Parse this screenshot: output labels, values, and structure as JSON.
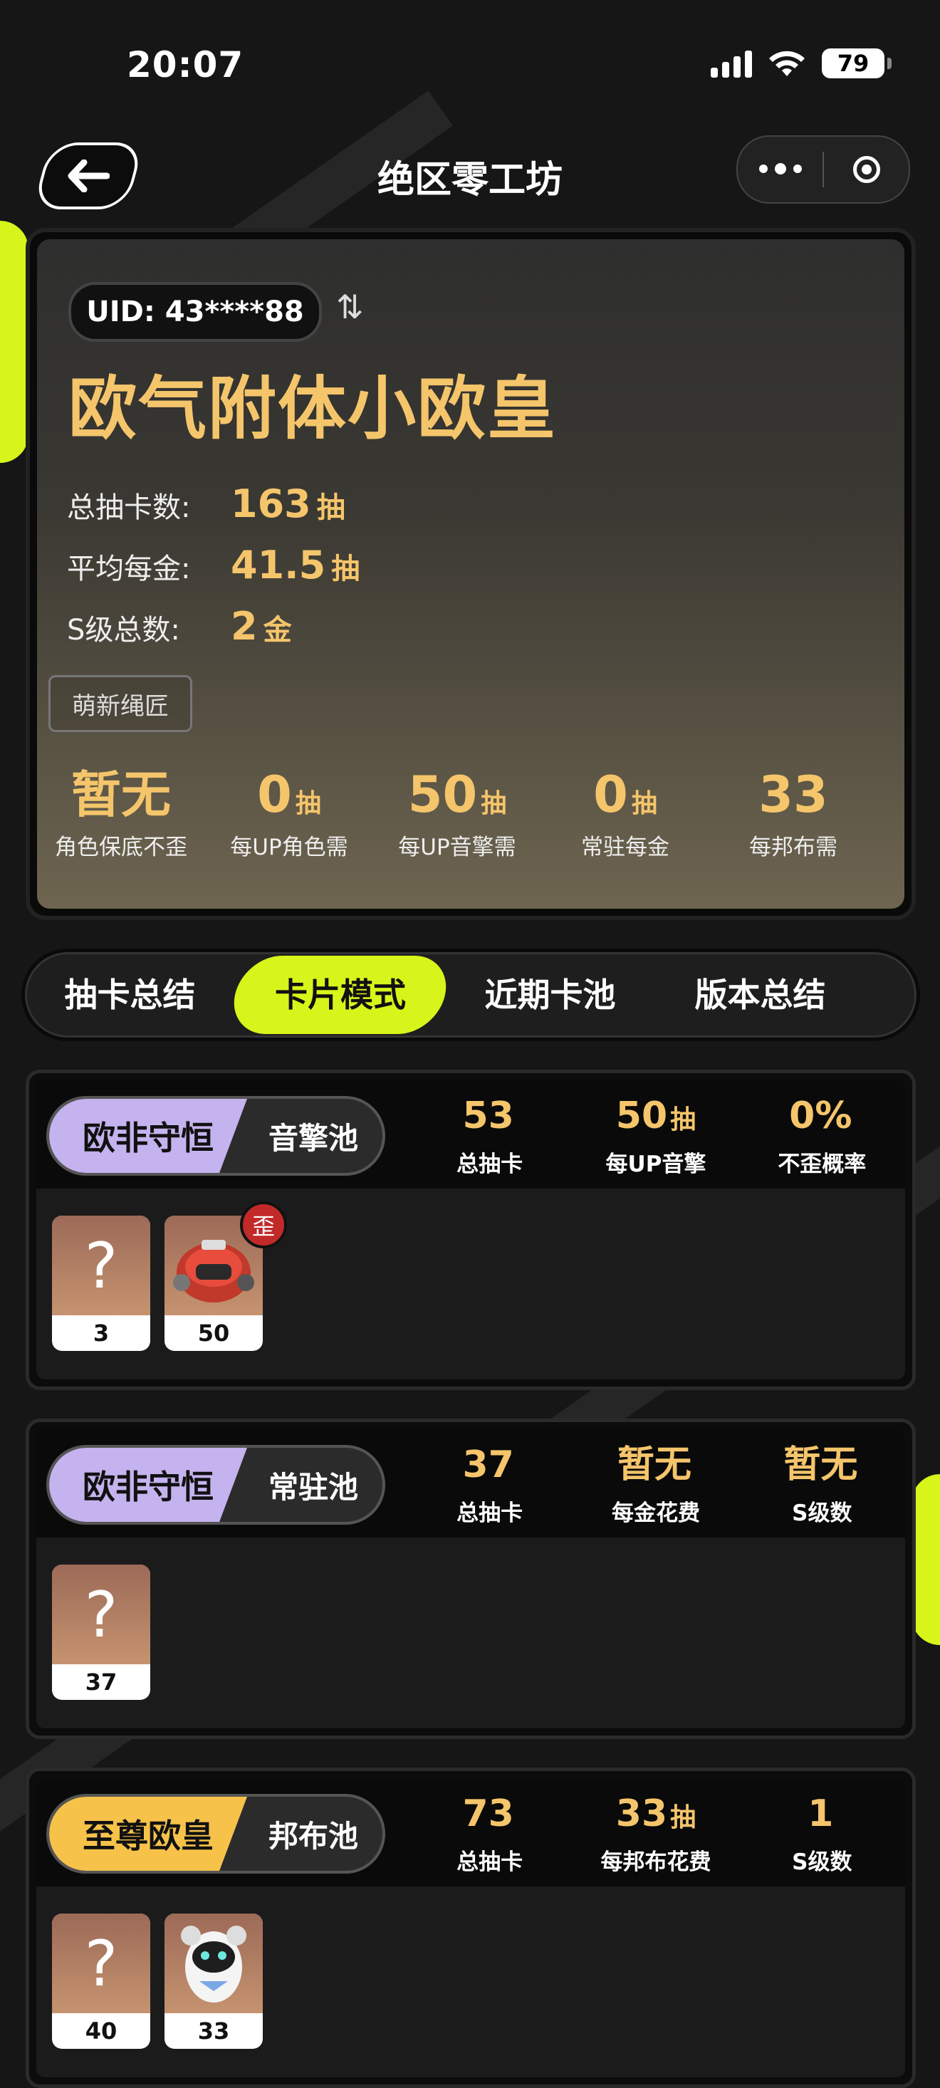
{
  "status_bar": {
    "time": "20:07",
    "battery": "79"
  },
  "nav": {
    "title": "绝区零工坊"
  },
  "profile": {
    "uid": "UID: 43****88",
    "swap_icon": "⇅",
    "title": "欧气附体小欧皇",
    "stats": [
      {
        "label": "总抽卡数:",
        "value": "163",
        "unit": "抽"
      },
      {
        "label": "平均每金:",
        "value": "41.5",
        "unit": "抽"
      },
      {
        "label": "S级总数:",
        "value": "2",
        "unit": "金"
      }
    ],
    "badge": "萌新绳匠",
    "summary": [
      {
        "value": "暂无",
        "unit": "",
        "caption": "角色保底不歪"
      },
      {
        "value": "0",
        "unit": "抽",
        "caption": "每UP角色需"
      },
      {
        "value": "50",
        "unit": "抽",
        "caption": "每UP音擎需"
      },
      {
        "value": "0",
        "unit": "抽",
        "caption": "常驻每金"
      },
      {
        "value": "33",
        "unit": "",
        "caption": "每邦布需"
      }
    ]
  },
  "tabs": [
    {
      "label": "抽卡总结"
    },
    {
      "label": "卡片模式"
    },
    {
      "label": "近期卡池"
    },
    {
      "label": "版本总结"
    }
  ],
  "pools": [
    {
      "grade": "欧非守恒",
      "name": "音擎池",
      "stats": [
        {
          "value": "53",
          "unit": "",
          "caption": "总抽卡"
        },
        {
          "value": "50",
          "unit": "抽",
          "caption": "每UP音擎"
        },
        {
          "value": "0%",
          "unit": "",
          "caption": "不歪概率"
        }
      ],
      "items": [
        {
          "count": "3",
          "icon": "question-mark-icon"
        },
        {
          "count": "50",
          "icon": "bangboo-helmet-icon",
          "badge": "歪"
        }
      ]
    },
    {
      "grade": "欧非守恒",
      "name": "常驻池",
      "stats": [
        {
          "value": "37",
          "unit": "",
          "caption": "总抽卡"
        },
        {
          "value": "暂无",
          "unit": "",
          "caption": "每金花费"
        },
        {
          "value": "暂无",
          "unit": "",
          "caption": "S级数"
        }
      ],
      "items": [
        {
          "count": "37",
          "icon": "question-mark-icon"
        }
      ]
    },
    {
      "grade": "至尊欧皇",
      "name": "邦布池",
      "stats": [
        {
          "value": "73",
          "unit": "",
          "caption": "总抽卡"
        },
        {
          "value": "33",
          "unit": "抽",
          "caption": "每邦布花费"
        },
        {
          "value": "1",
          "unit": "",
          "caption": "S级数"
        }
      ],
      "items": [
        {
          "count": "40",
          "icon": "question-mark-icon"
        },
        {
          "count": "33",
          "icon": "bangboo-sheep-icon"
        }
      ]
    }
  ],
  "question_glyph": "?",
  "colors": {
    "accent": "#d7f51a",
    "gold": "#f5c56b",
    "purple_grade": "#c4b3ee",
    "gold_grade": "#f6c24a"
  }
}
